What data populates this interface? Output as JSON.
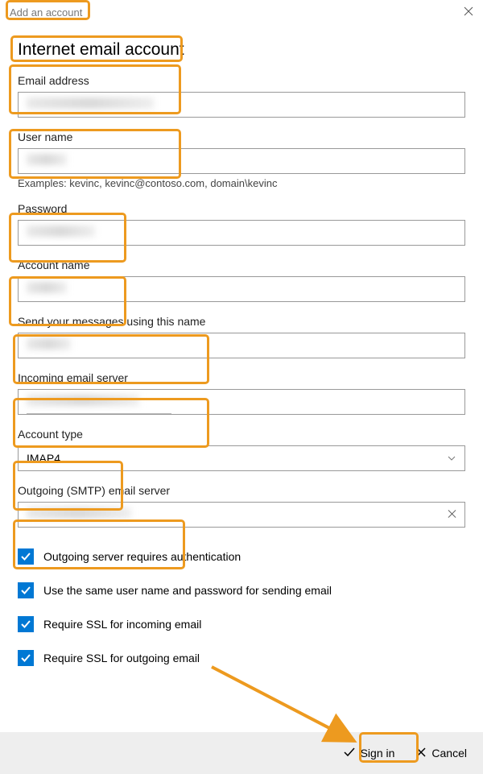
{
  "titlebar": {
    "text": "Add an account"
  },
  "heading": "Internet email account",
  "fields": {
    "email": {
      "label": "Email address"
    },
    "username": {
      "label": "User name",
      "help": "Examples: kevinc, kevinc@contoso.com, domain\\kevinc"
    },
    "password": {
      "label": "Password"
    },
    "account_name": {
      "label": "Account name"
    },
    "send_name": {
      "label": "Send your messages using this name"
    },
    "incoming": {
      "label": "Incoming email server"
    },
    "account_type": {
      "label": "Account type",
      "value": "IMAP4"
    },
    "outgoing": {
      "label": "Outgoing (SMTP) email server"
    }
  },
  "checkboxes": {
    "c1": "Outgoing server requires authentication",
    "c2": "Use the same user name and password for sending email",
    "c3": "Require SSL for incoming email",
    "c4": "Require SSL for outgoing email"
  },
  "buttons": {
    "signin": "Sign in",
    "cancel": "Cancel"
  }
}
